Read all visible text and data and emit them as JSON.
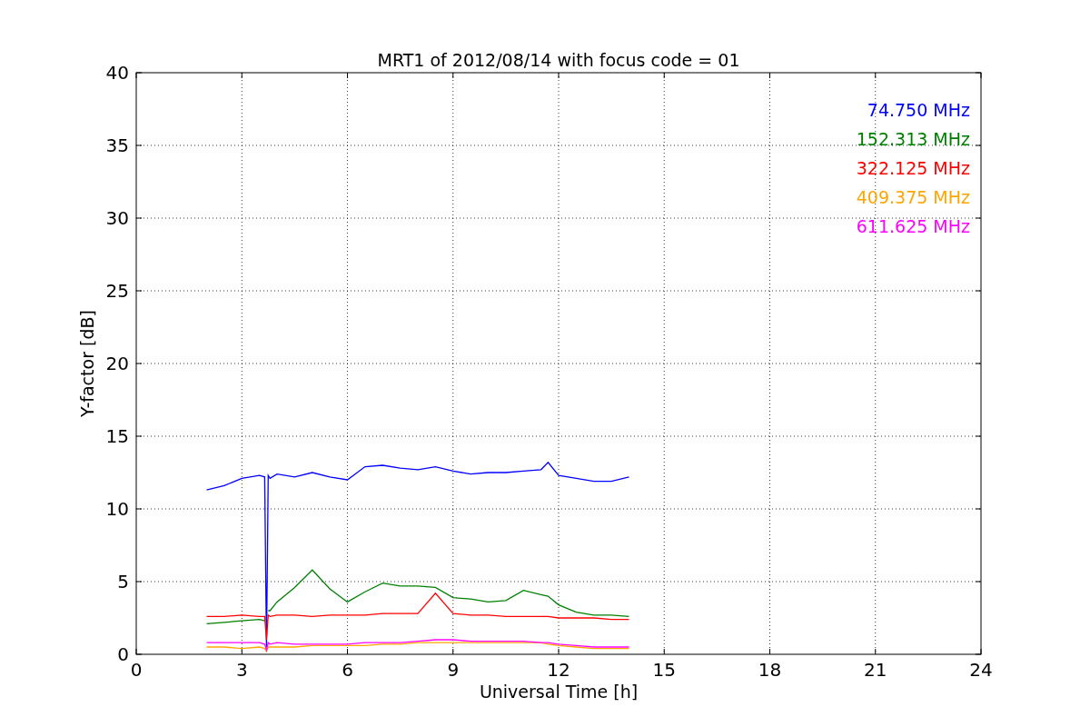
{
  "figure": {
    "chart_data": {
      "type": "line",
      "title": "MRT1 of 2012/08/14 with focus code = 01",
      "xlabel": "Universal Time [h]",
      "ylabel": "Y-factor [dB]",
      "x": [
        2,
        2.5,
        3,
        3.5,
        3.65,
        3.7,
        3.75,
        3.8,
        4,
        4.5,
        5,
        5.5,
        6,
        6.5,
        7,
        7.5,
        8,
        8.5,
        9,
        9.5,
        10,
        10.5,
        11,
        11.5,
        11.7,
        12,
        12.5,
        13,
        13.5,
        14
      ],
      "series": [
        {
          "name": "74.750 MHz",
          "color": "#0000ff",
          "values": [
            11.3,
            11.6,
            12.1,
            12.3,
            12.2,
            0.5,
            12.3,
            12.1,
            12.4,
            12.2,
            12.5,
            12.2,
            12.0,
            12.9,
            13.0,
            12.8,
            12.7,
            12.9,
            12.6,
            12.4,
            12.5,
            12.5,
            12.6,
            12.7,
            13.2,
            12.3,
            12.1,
            11.9,
            11.9,
            12.2
          ]
        },
        {
          "name": "152.313 MHz",
          "color": "#008000",
          "values": [
            2.1,
            2.2,
            2.3,
            2.4,
            2.3,
            null,
            3.0,
            3.0,
            3.6,
            4.6,
            5.8,
            4.5,
            3.6,
            4.3,
            4.9,
            4.7,
            4.7,
            4.6,
            3.9,
            3.8,
            3.6,
            3.7,
            4.4,
            4.1,
            4.0,
            3.4,
            2.9,
            2.7,
            2.7,
            2.6
          ]
        },
        {
          "name": "322.125 MHz",
          "color": "#ff0000",
          "values": [
            2.6,
            2.6,
            2.7,
            2.6,
            2.6,
            1.0,
            2.7,
            2.6,
            2.7,
            2.7,
            2.6,
            2.7,
            2.7,
            2.7,
            2.8,
            2.8,
            2.8,
            4.2,
            2.8,
            2.7,
            2.7,
            2.6,
            2.6,
            2.6,
            2.6,
            2.5,
            2.5,
            2.5,
            2.4,
            2.4
          ]
        },
        {
          "name": "409.375 MHz",
          "color": "#ffa500",
          "values": [
            0.5,
            0.5,
            0.4,
            0.5,
            0.4,
            0.2,
            0.5,
            0.5,
            0.5,
            0.5,
            0.6,
            0.6,
            0.6,
            0.6,
            0.7,
            0.7,
            0.8,
            0.8,
            0.8,
            0.8,
            0.8,
            0.8,
            0.8,
            0.8,
            0.7,
            0.6,
            0.5,
            0.4,
            0.4,
            0.4
          ]
        },
        {
          "name": "611.625 MHz",
          "color": "#ff00ff",
          "values": [
            0.8,
            0.8,
            0.8,
            0.8,
            0.7,
            0.3,
            0.8,
            0.7,
            0.8,
            0.7,
            0.7,
            0.7,
            0.7,
            0.8,
            0.8,
            0.8,
            0.9,
            1.0,
            1.0,
            0.9,
            0.9,
            0.9,
            0.9,
            0.8,
            0.8,
            0.7,
            0.6,
            0.5,
            0.5,
            0.5
          ]
        }
      ],
      "grid": true,
      "xlim": [
        0,
        24
      ],
      "ylim": [
        0,
        40
      ],
      "xticks": [
        0,
        3,
        6,
        9,
        12,
        15,
        18,
        21,
        24
      ],
      "yticks": [
        0,
        5,
        10,
        15,
        20,
        25,
        30,
        35,
        40
      ]
    }
  }
}
